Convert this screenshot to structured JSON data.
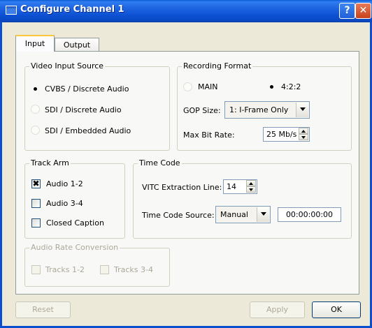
{
  "window": {
    "title": "Configure Channel 1",
    "help_glyph": "?",
    "close_glyph": "✕"
  },
  "tabs": [
    {
      "label": "Input",
      "selected": true
    },
    {
      "label": "Output",
      "selected": false
    }
  ],
  "video_input_source": {
    "legend": "Video Input Source",
    "options": [
      {
        "label": "CVBS / Discrete Audio",
        "selected": true
      },
      {
        "label": "SDI / Discrete Audio",
        "selected": false
      },
      {
        "label": "SDI / Embedded Audio",
        "selected": false
      }
    ]
  },
  "recording_format": {
    "legend": "Recording Format",
    "options": [
      {
        "label": "MAIN",
        "selected": false
      },
      {
        "label": "4:2:2",
        "selected": true
      }
    ],
    "gop_label": "GOP Size:",
    "gop_value": "1: I-Frame Only",
    "bitrate_label": "Max Bit Rate:",
    "bitrate_value": "25 Mb/s"
  },
  "track_arm": {
    "legend": "Track Arm",
    "items": [
      {
        "label": "Audio 1-2",
        "checked": true
      },
      {
        "label": "Audio 3-4",
        "checked": false
      },
      {
        "label": "Closed Caption",
        "checked": false
      }
    ]
  },
  "time_code": {
    "legend": "Time Code",
    "vitc_label": "VITC Extraction Line:",
    "vitc_value": "14",
    "source_label": "Time Code Source:",
    "source_value": "Manual",
    "timecode_value": "00:00:00:00"
  },
  "audio_rate_conversion": {
    "legend": "Audio Rate Conversion",
    "items": [
      {
        "label": "Tracks 1-2",
        "checked": false
      },
      {
        "label": "Tracks 3-4",
        "checked": false
      }
    ]
  },
  "buttons": {
    "reset": "Reset",
    "apply": "Apply",
    "ok": "OK"
  },
  "colors": {
    "titlebar": "#0b4fd1",
    "dialog_bg": "#ece9d8",
    "tab_highlight": "#ffc83c"
  }
}
